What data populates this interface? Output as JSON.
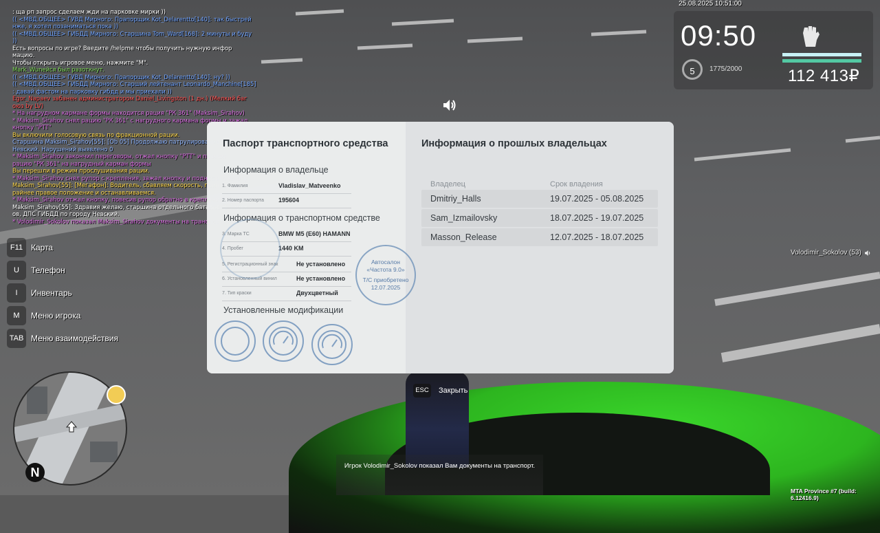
{
  "chat": [
    {
      "text": ": ща рп запрос сделаем жди на парковке мирки ))",
      "color": "#ffffff"
    },
    {
      "text": "(( <МВД.ОБЩЕЕ> ГУВД Мирного: Прапорщик Kot_Delarentto[140]: так быстрей",
      "color": "#6fa3ff"
    },
    {
      "text": "нже, я хотел позаниматься пока ))",
      "color": "#6fa3ff"
    },
    {
      "text": "(( <МВД.ОБЩЕЕ> ГИБДД Мирного: Старшина Tom_Ward[168]: 2 минуты и буду",
      "color": "#6fa3ff"
    },
    {
      "text": "))",
      "color": "#6fa3ff"
    },
    {
      "text": "Есть вопросы по игре? Введите /helpme чтобы получить нужную инфор",
      "color": "#ffffff"
    },
    {
      "text": "мацию.",
      "color": "#ffffff"
    },
    {
      "text": "Чтобы открыть игровое меню, нажмите \"M\".",
      "color": "#ffffff"
    },
    {
      "text": "Mark_Wuneйся был разоткнут.",
      "color": "#7ed957"
    },
    {
      "text": "(( <МВД.ОБЩЕЕ> ГУВД Мирного: Прапорщик Kot_Delarentto[140]: ну? ))",
      "color": "#6fa3ff"
    },
    {
      "text": "(( <МВД.ОБЩЕЕ> ГИБДД Мирного: Старший лейтенант Leonardo_Manchine[185]",
      "color": "#6fa3ff"
    },
    {
      "text": ": давай фастом на парковку гибдд и мы приехали ))",
      "color": "#6fa3ff"
    },
    {
      "text": "Egor_Napaev забанен администратором Daniel_Livingston (1 дн.) (Мелкий баг",
      "color": "#ff4d4d"
    },
    {
      "text": "оюз by LV)",
      "color": "#ff4d4d"
    },
    {
      "text": "* На нагрудном кармане формы находится рация \"РК 361\" (Maksim_Sirahov)",
      "color": "#d86be0"
    },
    {
      "text": "* Maksim_Sirahov снял рацию \"РК 361\" с нагрудного кармана формы и зажал",
      "color": "#d86be0"
    },
    {
      "text": "кнопку \"PTT\"",
      "color": "#d86be0"
    },
    {
      "text": "Вы включили голосовую связь по фракционной рации.",
      "color": "#ffd84a"
    },
    {
      "text": "Старшина Maksim_Sirahov[55]: [Ob 05] Продолжаю патрулирование города",
      "color": "#8db4ff"
    },
    {
      "text": " Невский. Нарушений выявлено 0",
      "color": "#8db4ff"
    },
    {
      "text": "* Maksim_Sirahov закончил переговоры, отжал кнопку \"PTT\" и повесил",
      "color": "#d86be0"
    },
    {
      "text": "рацию \"РК 361\" на нагрудный карман формы",
      "color": "#d86be0"
    },
    {
      "text": "Вы перешли в режим прослушивания рации.",
      "color": "#ffd84a"
    },
    {
      "text": "* Maksim_Sirahov снял рупор с крепления, зажал кнопку и поднёс его ко рту",
      "color": "#d86be0"
    },
    {
      "text": "Maksim_Sirahov[55]: [Мегафон]: Водитель, сбавляем скорость, принимаем к",
      "color": "#ffd84a"
    },
    {
      "text": "райнее правое положение и останавливаемся.",
      "color": "#ffd84a"
    },
    {
      "text": "* Maksim_Sirahov отжал кнопку, повесив рупор обратно в крепление",
      "color": "#d86be0"
    },
    {
      "text": "Maksim_Sirahov[55]: Здравия желаю, старшина отдельного батальона Сирах",
      "color": "#ffffff"
    },
    {
      "text": "ов, ДПС ГИБДД по городу Невский.",
      "color": "#ffffff"
    },
    {
      "text": "* Volodimir_Sokolov показал Maksim_Sirahov документы на транспорт",
      "color": "#d86be0"
    }
  ],
  "datetime": "25.08.2025 10:51:00",
  "hud": {
    "time": "09:50",
    "level": "5",
    "exp": "1775/2000",
    "money": "112 413₽"
  },
  "menu": [
    {
      "key": "F11",
      "label": "Карта"
    },
    {
      "key": "U",
      "label": "Телефон"
    },
    {
      "key": "I",
      "label": "Инвентарь"
    },
    {
      "key": "M",
      "label": "Меню игрока"
    },
    {
      "key": "TAB",
      "label": "Меню взаимодействия"
    }
  ],
  "minimap": {
    "north": "N"
  },
  "passport": {
    "title": "Паспорт транспортного средства",
    "owner_section": "Информация о владельце",
    "fields_owner": [
      {
        "label": "1. Фамилия",
        "value": "Vladislav_Matveenko"
      },
      {
        "label": "2. Номер паспорта",
        "value": "195604"
      }
    ],
    "vehicle_section": "Информация о транспортном средстве",
    "fields_vehicle": [
      {
        "label": "3. Марка ТС",
        "value": "BMW M5 (E60) HAMANN"
      },
      {
        "label": "4. Пробег",
        "value": "1440 KM"
      },
      {
        "label": "5. Регистрационный знак",
        "value": "Не установлено"
      },
      {
        "label": "6. Установленный винил",
        "value": "Не установлено"
      },
      {
        "label": "7. Тип краски",
        "value": "Двухцветный"
      }
    ],
    "mods_section": "Установленные модификации",
    "dealer_stamp": [
      "Автосалон",
      "«Частота 9.0»",
      "Т/С приобретено",
      "12.07.2025"
    ]
  },
  "owners": {
    "title": "Информация о прошлых владельцах",
    "col_owner": "Владелец",
    "col_period": "Срок владения",
    "rows": [
      {
        "name": "Dmitriy_Halls",
        "period": "19.07.2025 - 05.08.2025"
      },
      {
        "name": "Sam_Izmailovsky",
        "period": "18.07.2025 - 19.07.2025"
      },
      {
        "name": "Masson_Release",
        "period": "12.07.2025 - 18.07.2025"
      }
    ]
  },
  "close": {
    "key": "ESC",
    "label": "Закрыть"
  },
  "notification": "Игрок Volodimir_Sokolov показал Вам документы на транспорт.",
  "nametag": "Volodimir_Sokolov (53)",
  "build": "MTA Province #7 (build: 6.12416.9)",
  "colors": {
    "accent_green": "#2db51f",
    "level_bar": "#53c9a3"
  }
}
